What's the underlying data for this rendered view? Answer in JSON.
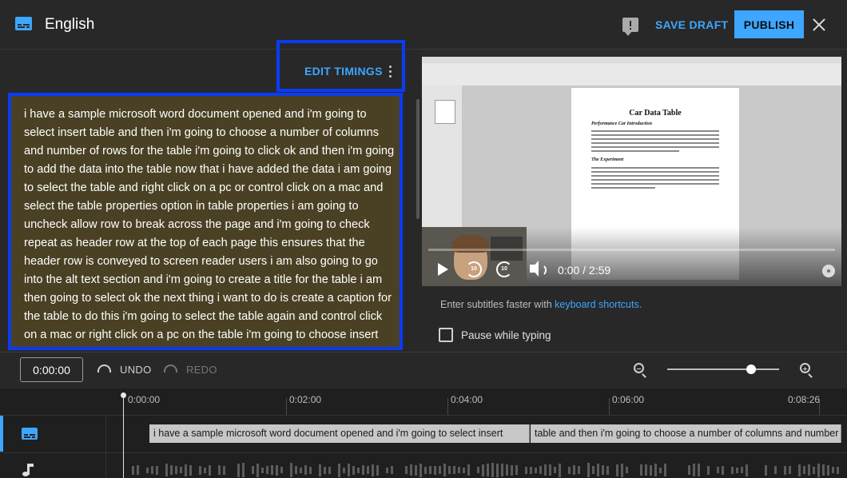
{
  "header": {
    "title": "English",
    "save_draft": "SAVE DRAFT",
    "publish": "PUBLISH"
  },
  "editor": {
    "edit_timings": "EDIT TIMINGS",
    "transcript": "i have a sample microsoft word document opened and i'm going to select insert table and then i'm going to choose a number of columns and number of rows for the table i'm going to click ok and then i'm going to add the data into the table now that i have added the data i am going to select the table and right click on a pc or control click on a mac and select the table properties option in table properties i am going to uncheck allow row to break across the page and i'm going to check repeat as header row at the top of each page this ensures that the header row is conveyed to screen reader users i am also going to go into the alt text section and i'm going to create a title for the table i am then going to select ok the next thing i want to do is create a caption for the table to do this i'm going to select the table again and control click on a mac or right click on a pc on the table i'm going to choose insert"
  },
  "video": {
    "doc_title": "Car Data Table",
    "doc_heading_1": "Performance Car Introduction",
    "doc_heading_2": "The Experiment",
    "rewind_label": "10",
    "forward_label": "10",
    "time": "0:00 / 2:59",
    "progress": 0
  },
  "helper": {
    "hint_prefix": "Enter subtitles faster with ",
    "hint_link": "keyboard shortcuts.",
    "pause_label": "Pause while typing",
    "pause_checked": false
  },
  "timeline": {
    "timecode": "0:00:00",
    "undo": "UNDO",
    "redo": "REDO",
    "ruler": [
      "0:00:00",
      "0:02:00",
      "0:04:00",
      "0:06:00",
      "0:08:26"
    ],
    "captions": [
      "i have a sample microsoft word document  opened and i'm going to select insert",
      "table and then i'm going to choose a number  of columns and number"
    ]
  },
  "colors": {
    "accent": "#3ea6ff",
    "highlight_outline": "#0a3bf5",
    "transcript_bg": "#4a4124"
  }
}
